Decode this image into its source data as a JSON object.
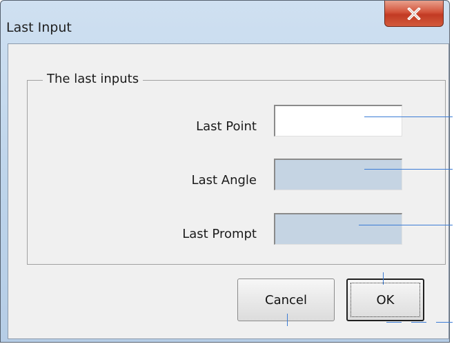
{
  "window": {
    "title": "Last Input"
  },
  "icons": {
    "close": "close-icon"
  },
  "group": {
    "label": "The last inputs",
    "fields": [
      {
        "label": "Last Point",
        "value": ""
      },
      {
        "label": "Last Angle",
        "value": ""
      },
      {
        "label": "Last Prompt",
        "value": ""
      }
    ]
  },
  "buttons": {
    "cancel": "Cancel",
    "ok": "OK"
  },
  "colors": {
    "titlebar": "#bcd3ea",
    "close_button": "#c23a23",
    "disabled_field": "#c5d4e3",
    "annotation_line": "#3a7bd5"
  }
}
